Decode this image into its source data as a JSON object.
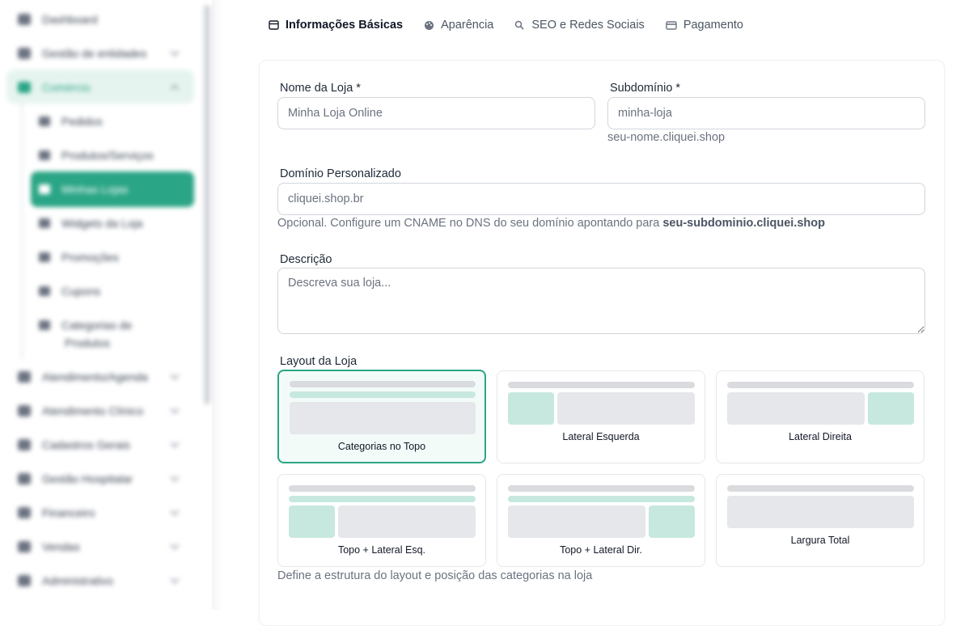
{
  "sidebar": {
    "items": [
      {
        "label": "Dashboard",
        "icon": "dashboard-icon"
      },
      {
        "label": "Gestão de entidades",
        "icon": "entities-icon"
      },
      {
        "label": "Comércio",
        "icon": "store-icon"
      },
      {
        "label": "Atendimento/Agenda",
        "icon": "calendar-icon"
      },
      {
        "label": "Atendimento Clínico",
        "icon": "clinic-icon"
      },
      {
        "label": "Cadastros Gerais",
        "icon": "pen-icon"
      },
      {
        "label": "Gestão Hospitalar",
        "icon": "hospital-icon"
      },
      {
        "label": "Financeiro",
        "icon": "dollar-icon"
      },
      {
        "label": "Vendas",
        "icon": "tag-icon"
      },
      {
        "label": "Administrativo",
        "icon": "building-icon"
      }
    ],
    "commerce_sub": [
      {
        "label": "Pedidos",
        "icon": "cart-icon"
      },
      {
        "label": "Produtos/Serviços",
        "icon": "box-icon"
      },
      {
        "label": "Minhas Lojas",
        "icon": "shop-icon"
      },
      {
        "label": "Widgets da Loja",
        "icon": "widget-icon"
      },
      {
        "label": "Promoções",
        "icon": "tag-icon"
      },
      {
        "label": "Cupons",
        "icon": "ticket-icon"
      },
      {
        "label": "Categorias de",
        "icon": "category-icon"
      },
      {
        "label": "Produtos",
        "icon": ""
      }
    ]
  },
  "tabs": [
    {
      "label": "Informações Básicas",
      "icon": "store-icon",
      "active": true
    },
    {
      "label": "Aparência",
      "icon": "palette-icon",
      "active": false
    },
    {
      "label": "SEO e Redes Sociais",
      "icon": "search-icon",
      "active": false
    },
    {
      "label": "Pagamento",
      "icon": "card-icon",
      "active": false
    }
  ],
  "form": {
    "store_name": {
      "label": "Nome da Loja *",
      "placeholder": "Minha Loja Online"
    },
    "subdomain": {
      "label": "Subdomínio *",
      "placeholder": "minha-loja",
      "help": "seu-nome.cliquei.shop"
    },
    "custom_domain": {
      "label": "Domínio Personalizado",
      "placeholder": "cliquei.shop.br",
      "help_prefix": "Opcional. Configure um CNAME no DNS do seu domínio apontando para ",
      "help_bold": "seu-subdominio.cliquei.shop"
    },
    "description": {
      "label": "Descrição",
      "placeholder": "Descreva sua loja..."
    },
    "layout": {
      "label": "Layout da Loja",
      "help": "Define a estrutura do layout e posição das categorias na loja",
      "options": [
        {
          "label": "Categorias no Topo",
          "selected": true
        },
        {
          "label": "Lateral Esquerda",
          "selected": false
        },
        {
          "label": "Lateral Direita",
          "selected": false
        },
        {
          "label": "Topo + Lateral Esq.",
          "selected": false
        },
        {
          "label": "Topo + Lateral Dir.",
          "selected": false
        },
        {
          "label": "Largura Total",
          "selected": false
        }
      ]
    }
  },
  "colors": {
    "accent": "#2aa585",
    "accent_light": "#c7e8df"
  }
}
